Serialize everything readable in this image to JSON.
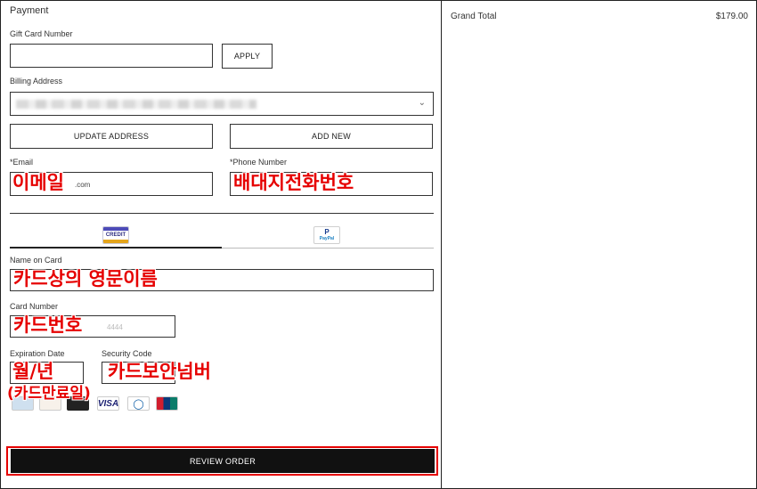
{
  "payment": {
    "title": "Payment",
    "gift_card": {
      "label": "Gift Card Number",
      "value": "",
      "apply_label": "APPLY"
    },
    "billing": {
      "label": "Billing Address",
      "selected_value": "",
      "update_label": "UPDATE ADDRESS",
      "add_new_label": "ADD NEW"
    },
    "email": {
      "label": "*Email",
      "value_suffix": ".com",
      "overlay": "이메일"
    },
    "phone": {
      "label": "*Phone Number",
      "overlay": "배대지전화번호"
    },
    "tabs": [
      {
        "label": "CREDIT",
        "icon": "credit-card-icon",
        "active": true
      },
      {
        "label": "PayPal",
        "icon": "paypal-icon",
        "active": false
      }
    ],
    "name_on_card": {
      "label": "Name on Card",
      "overlay": "카드상의 영문이름"
    },
    "card_number": {
      "label": "Card Number",
      "placeholder_tail": "4444",
      "overlay": "카드번호"
    },
    "expiration": {
      "label": "Expiration Date",
      "overlay": "월/년",
      "note_overlay": "(카드만료일)"
    },
    "security": {
      "label": "Security Code",
      "overlay": "카드보안넘버"
    },
    "card_logos": [
      {
        "name": "amex-icon",
        "text": ""
      },
      {
        "name": "discover-icon",
        "text": ""
      },
      {
        "name": "black-card-icon",
        "text": ""
      },
      {
        "name": "visa-icon",
        "text": "VISA"
      },
      {
        "name": "diners-club-icon",
        "text": ""
      },
      {
        "name": "unionpay-icon",
        "text": ""
      }
    ],
    "review_label": "REVIEW ORDER"
  },
  "summary": {
    "grand_total_label": "Grand Total",
    "grand_total_value": "$179.00"
  },
  "colors": {
    "annotation_red": "#e60000",
    "primary_button": "#111111",
    "border": "#333333"
  }
}
